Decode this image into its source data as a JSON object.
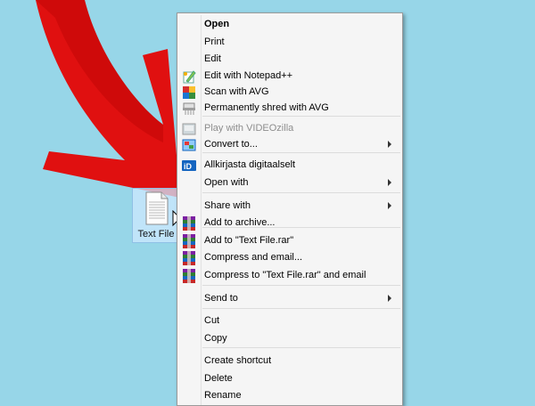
{
  "file": {
    "label": "Text File"
  },
  "menu": {
    "items": [
      {
        "label": "Open",
        "bold": true
      },
      {
        "label": "Print"
      },
      {
        "label": "Edit"
      },
      {
        "label": "Edit with Notepad++",
        "icon": "notepadpp-icon"
      },
      {
        "label": "Scan with AVG",
        "icon": "avg-icon"
      },
      {
        "label": "Permanently shred with AVG",
        "icon": "shredder-icon"
      },
      {
        "label": "Play with VIDEOzilla",
        "icon": "videozilla-icon",
        "disabled": true
      },
      {
        "label": "Convert to...",
        "icon": "convert-icon",
        "submenu": true
      },
      {
        "label": "Allkirjasta digitaalselt",
        "icon": "id-card-icon"
      },
      {
        "label": "Open with",
        "submenu": true
      },
      {
        "label": "Share with",
        "submenu": true
      },
      {
        "label": "Add to archive...",
        "icon": "winrar-icon"
      },
      {
        "label": "Add to \"Text File.rar\"",
        "icon": "winrar-icon"
      },
      {
        "label": "Compress and email...",
        "icon": "winrar-icon"
      },
      {
        "label": "Compress to \"Text File.rar\" and email",
        "icon": "winrar-icon"
      },
      {
        "label": "Send to",
        "submenu": true
      },
      {
        "label": "Cut"
      },
      {
        "label": "Copy"
      },
      {
        "label": "Create shortcut"
      },
      {
        "label": "Delete"
      },
      {
        "label": "Rename"
      }
    ]
  },
  "colors": {
    "desktop": "#97d6e8",
    "arrow": "#e01010",
    "menu_bg": "#f5f5f5"
  }
}
